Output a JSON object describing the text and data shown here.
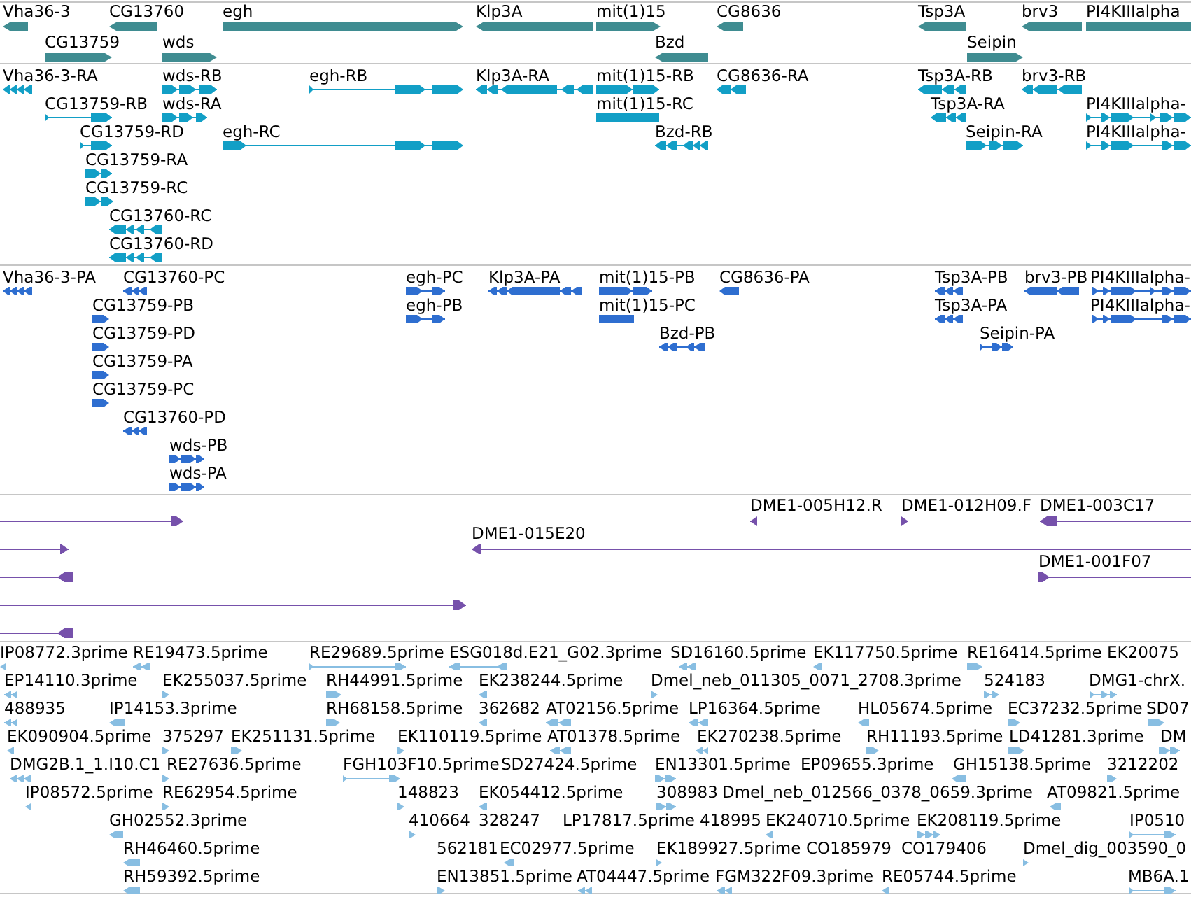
{
  "tracks": [
    {
      "kind": "gene",
      "features": [
        {
          "label": "Vha36-3",
          "reverse": true
        },
        {
          "label": "CG13760",
          "reverse": true
        },
        {
          "label": "egh",
          "reverse": false
        },
        {
          "label": "Klp3A",
          "reverse": true
        },
        {
          "label": "mit(1)15",
          "reverse": false
        },
        {
          "label": "CG8636",
          "reverse": true
        },
        {
          "label": "Tsp3A",
          "reverse": true
        },
        {
          "label": "brv3",
          "reverse": true
        },
        {
          "label": "PI4KIIIalpha"
        },
        {
          "label": "CG13759",
          "reverse": false
        },
        {
          "label": "wds",
          "reverse": false
        },
        {
          "label": "Bzd",
          "reverse": true
        },
        {
          "label": "Seipin",
          "reverse": false
        }
      ]
    },
    {
      "kind": "transcript",
      "features": [
        {
          "label": "Vha36-3-RA",
          "reverse": true
        },
        {
          "label": "wds-RB",
          "reverse": false
        },
        {
          "label": "egh-RB",
          "reverse": false
        },
        {
          "label": "Klp3A-RA",
          "reverse": true
        },
        {
          "label": "mit(1)15-RB",
          "reverse": false
        },
        {
          "label": "CG8636-RA",
          "reverse": true
        },
        {
          "label": "Tsp3A-RB",
          "reverse": true
        },
        {
          "label": "brv3-RB",
          "reverse": true
        },
        {
          "label": "CG13759-RB",
          "reverse": false
        },
        {
          "label": "wds-RA",
          "reverse": false
        },
        {
          "label": "mit(1)15-RC"
        },
        {
          "label": "Tsp3A-RA",
          "reverse": true
        },
        {
          "label": "PI4KIIIalpha-",
          "reverse": false
        },
        {
          "label": "CG13759-RD",
          "reverse": false
        },
        {
          "label": "egh-RC",
          "reverse": false
        },
        {
          "label": "Bzd-RB",
          "reverse": true
        },
        {
          "label": "Seipin-RA",
          "reverse": false
        },
        {
          "label": "PI4KIIIalpha-",
          "reverse": false
        },
        {
          "label": "CG13759-RA",
          "reverse": false
        },
        {
          "label": "CG13759-RC",
          "reverse": false
        },
        {
          "label": "CG13760-RC",
          "reverse": true
        },
        {
          "label": "CG13760-RD",
          "reverse": true
        }
      ]
    },
    {
      "kind": "protein",
      "features": [
        {
          "label": "Vha36-3-PA",
          "reverse": true
        },
        {
          "label": "CG13760-PC",
          "reverse": true
        },
        {
          "label": "egh-PC",
          "reverse": false
        },
        {
          "label": "Klp3A-PA",
          "reverse": true
        },
        {
          "label": "mit(1)15-PB",
          "reverse": false
        },
        {
          "label": "CG8636-PA",
          "reverse": true
        },
        {
          "label": "Tsp3A-PB",
          "reverse": true
        },
        {
          "label": "brv3-PB",
          "reverse": true
        },
        {
          "label": "PI4KIIIalpha-",
          "reverse": false
        },
        {
          "label": "CG13759-PB",
          "reverse": false
        },
        {
          "label": "egh-PB",
          "reverse": false
        },
        {
          "label": "mit(1)15-PC"
        },
        {
          "label": "Tsp3A-PA",
          "reverse": true
        },
        {
          "label": "PI4KIIIalpha-",
          "reverse": false
        },
        {
          "label": "CG13759-PD",
          "reverse": false
        },
        {
          "label": "Bzd-PB",
          "reverse": true
        },
        {
          "label": "Seipin-PA",
          "reverse": false
        },
        {
          "label": "CG13759-PA",
          "reverse": false
        },
        {
          "label": "CG13759-PC",
          "reverse": false
        },
        {
          "label": "CG13760-PD",
          "reverse": true
        },
        {
          "label": "wds-PB",
          "reverse": false
        },
        {
          "label": "wds-PA",
          "reverse": false
        }
      ]
    },
    {
      "kind": "clone",
      "features": [
        {
          "reverse": false
        },
        {
          "label": "DME1-005H12.R",
          "reverse": true
        },
        {
          "label": "DME1-012H09.F",
          "reverse": false
        },
        {
          "label": "DME1-003C17",
          "reverse": true
        },
        {
          "reverse": false
        },
        {
          "label": "DME1-015E20",
          "reverse": true
        },
        {
          "reverse": true
        },
        {
          "label": "DME1-001F07",
          "reverse": false
        },
        {
          "reverse": false
        },
        {
          "reverse": true
        }
      ]
    },
    {
      "kind": "est",
      "features": [
        {
          "label": "IP08772.3prime",
          "reverse": true
        },
        {
          "label": "RE19473.5prime",
          "reverse": true
        },
        {
          "label": "RE29689.5prime",
          "reverse": false
        },
        {
          "label": "ESG018d.E21_G02.3prime",
          "reverse": true
        },
        {
          "label": "SD16160.5prime",
          "reverse": true
        },
        {
          "label": "EK117750.5prime",
          "reverse": true
        },
        {
          "label": "RE16414.5prime",
          "reverse": false
        },
        {
          "label": "EK20075"
        },
        {
          "label": "EP14110.3prime",
          "reverse": true
        },
        {
          "label": "EK255037.5prime",
          "reverse": false
        },
        {
          "label": "RH44991.5prime",
          "reverse": false
        },
        {
          "label": "EK238244.5prime",
          "reverse": true
        },
        {
          "label": "Dmel_neb_011305_0071_2708.3prime",
          "reverse": false
        },
        {
          "label": "524183",
          "reverse": false
        },
        {
          "label": "DMG1-chrX.",
          "reverse": false
        },
        {
          "label": "488935",
          "reverse": true
        },
        {
          "label": "IP14153.3prime",
          "reverse": true
        },
        {
          "label": "RH68158.5prime",
          "reverse": false
        },
        {
          "label": "362682",
          "reverse": true
        },
        {
          "label": "AT02156.5prime",
          "reverse": true
        },
        {
          "label": "LP16364.5prime",
          "reverse": true
        },
        {
          "label": "HL05674.5prime",
          "reverse": true
        },
        {
          "label": "EC37232.5prime",
          "reverse": false
        },
        {
          "label": "SD07",
          "reverse": false
        },
        {
          "label": "EK090904.5prime",
          "reverse": true
        },
        {
          "label": "375297",
          "reverse": false
        },
        {
          "label": "EK251131.5prime",
          "reverse": false
        },
        {
          "label": "EK110119.5prime",
          "reverse": false
        },
        {
          "label": "AT01378.5prime",
          "reverse": true
        },
        {
          "label": "EK270238.5prime",
          "reverse": true
        },
        {
          "label": "RH11193.5prime",
          "reverse": false
        },
        {
          "label": "LD41281.3prime",
          "reverse": false
        },
        {
          "label": "DM",
          "reverse": false
        },
        {
          "label": "DMG2B.1_1.I10.C1",
          "reverse": true
        },
        {
          "label": "RE27636.5prime",
          "reverse": false
        },
        {
          "label": "FGH103F10.5prime",
          "reverse": false
        },
        {
          "label": "SD27424.5prime"
        },
        {
          "label": "EN13301.5prime",
          "reverse": false
        },
        {
          "label": "EP09655.3prime"
        },
        {
          "label": "GH15138.5prime",
          "reverse": true
        },
        {
          "label": "3212202",
          "reverse": false
        },
        {
          "label": "IP08572.5prime",
          "reverse": true
        },
        {
          "label": "RE62954.5prime",
          "reverse": false
        },
        {
          "label": "148823",
          "reverse": false
        },
        {
          "label": "EK054412.5prime",
          "reverse": true
        },
        {
          "label": "308983",
          "reverse": false
        },
        {
          "label": "Dmel_neb_012566_0378_0659.3prime"
        },
        {
          "label": "AT09821.5prime",
          "reverse": true
        },
        {
          "label": "GH02552.3prime",
          "reverse": true
        },
        {
          "label": "410664",
          "reverse": false
        },
        {
          "label": "328247"
        },
        {
          "label": "LP17817.5prime"
        },
        {
          "label": "418995"
        },
        {
          "label": "EK240710.5prime",
          "reverse": true
        },
        {
          "label": "EK208119.5prime",
          "reverse": false
        },
        {
          "label": "IP0510",
          "reverse": false
        },
        {
          "label": "RH46460.5prime",
          "reverse": true
        },
        {
          "label": "562181"
        },
        {
          "label": "EC02977.5prime",
          "reverse": true
        },
        {
          "label": "EK189927.5prime",
          "reverse": false
        },
        {
          "label": "CO185979"
        },
        {
          "label": "CO179406"
        },
        {
          "label": "Dmel_dig_003590_0",
          "reverse": false
        },
        {
          "label": "RH59392.5prime",
          "reverse": true
        },
        {
          "label": "EN13851.5prime",
          "reverse": false
        },
        {
          "label": "AT04447.5prime",
          "reverse": true
        },
        {
          "label": "FGM322F09.3prime",
          "reverse": true
        },
        {
          "label": "RE05744.5prime",
          "reverse": true
        },
        {
          "label": "MB6A.1",
          "reverse": false
        }
      ]
    }
  ]
}
